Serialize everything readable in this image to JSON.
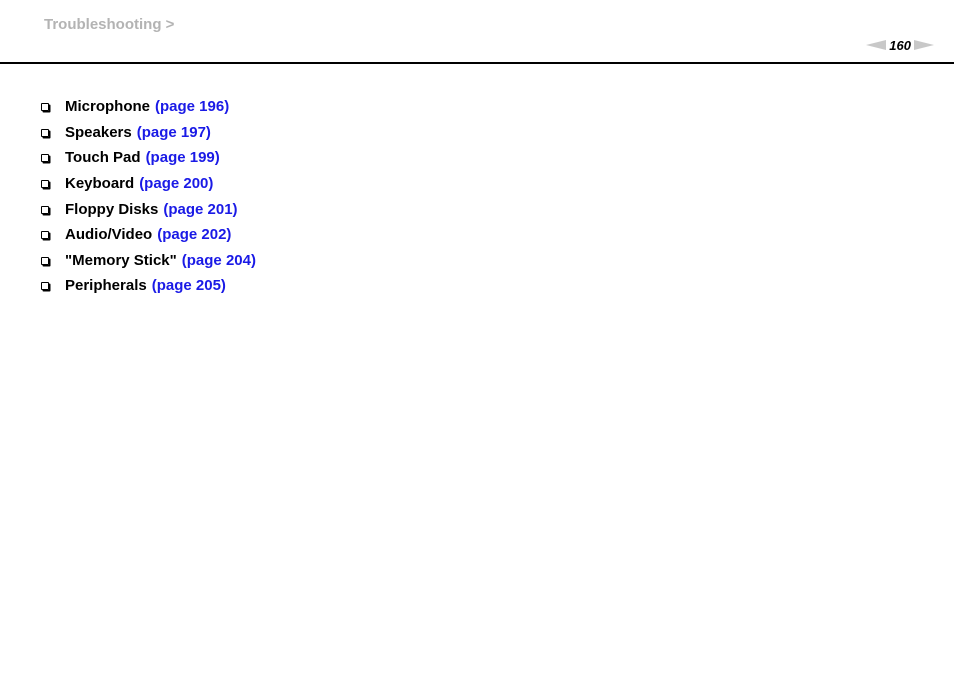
{
  "header": {
    "breadcrumb": "Troubleshooting >",
    "page_number": "160",
    "prev_icon": "triangle-left-icon",
    "next_icon": "triangle-right-icon"
  },
  "colors": {
    "breadcrumb": "#b3b3b3",
    "link": "#1a1ae6",
    "text": "#000000",
    "nav_arrow": "#c8c8c8"
  },
  "topics": [
    {
      "label": "Microphone",
      "link": "(page 196)"
    },
    {
      "label": "Speakers",
      "link": "(page 197)"
    },
    {
      "label": "Touch Pad",
      "link": "(page 199)"
    },
    {
      "label": "Keyboard",
      "link": "(page 200)"
    },
    {
      "label": "Floppy Disks",
      "link": "(page 201)"
    },
    {
      "label": "Audio/Video",
      "link": "(page 202)"
    },
    {
      "label": "\"Memory Stick\"",
      "link": "(page 204)"
    },
    {
      "label": "Peripherals",
      "link": "(page 205)"
    }
  ]
}
